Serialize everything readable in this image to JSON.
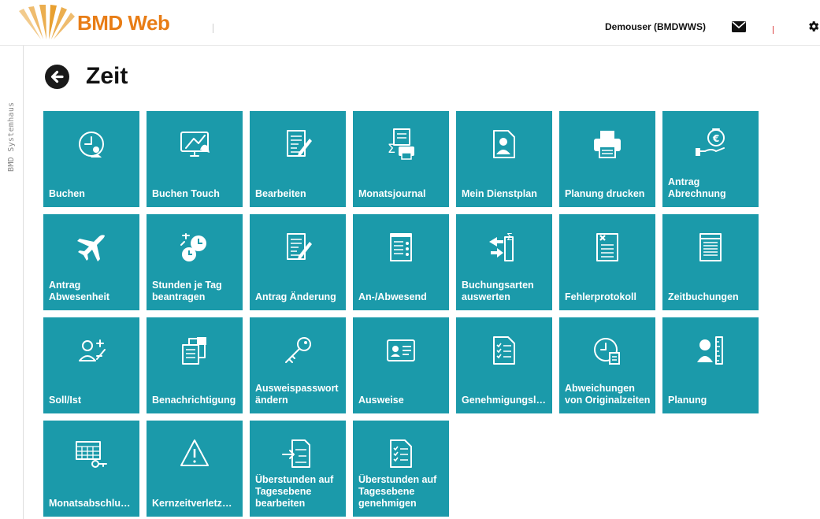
{
  "app": {
    "logo_text": "BMD Web",
    "user": "Demouser (BMDWWS)",
    "side_label": "BMD Systemhaus"
  },
  "colors": {
    "tile": "#1b9aaa",
    "brand": "#e87d16"
  },
  "page": {
    "title": "Zeit"
  },
  "tiles": [
    {
      "label": "Buchen",
      "icon": "clock-person-icon"
    },
    {
      "label": "Buchen Touch",
      "icon": "touch-monitor-icon"
    },
    {
      "label": "Bearbeiten",
      "icon": "edit-document-icon"
    },
    {
      "label": "Monatsjournal",
      "icon": "journal-printer-icon"
    },
    {
      "label": "Mein Dienstplan",
      "icon": "person-document-icon"
    },
    {
      "label": "Planung drucken",
      "icon": "printer-icon"
    },
    {
      "label": "Antrag\nAbrechnung",
      "icon": "money-bag-hand-icon"
    },
    {
      "label": "Antrag\nAbwesenheit",
      "icon": "airplane-icon"
    },
    {
      "label": "Stunden je Tag\nbeantragen",
      "icon": "clock-arrows-icon"
    },
    {
      "label": "Antrag Änderung",
      "icon": "edit-document-icon"
    },
    {
      "label": "An-/Abwesend",
      "icon": "notepad-status-icon"
    },
    {
      "label": "Buchungsarten\nauswerten",
      "icon": "sum-arrows-icon"
    },
    {
      "label": "Fehlerprotokoll",
      "icon": "document-error-icon"
    },
    {
      "label": "Zeitbuchungen",
      "icon": "list-document-icon"
    },
    {
      "label": "Soll/Ist",
      "icon": "person-plus-minus-icon"
    },
    {
      "label": "Benachrichtigung",
      "icon": "documents-stack-icon"
    },
    {
      "label": "Ausweispasswort\nändern",
      "icon": "key-icon"
    },
    {
      "label": "Ausweise",
      "icon": "id-card-icon"
    },
    {
      "label": "Genehmigungsli…",
      "icon": "checklist-document-icon"
    },
    {
      "label": "Abweichungen\nvon Originalzeiten",
      "icon": "clock-document-icon"
    },
    {
      "label": "Planung",
      "icon": "person-ruler-icon"
    },
    {
      "label": "Monatsabschlus…",
      "icon": "calendar-key-icon"
    },
    {
      "label": "Kernzeitverletzu…",
      "icon": "warning-icon"
    },
    {
      "label": "Überstunden auf\nTagesebene\nbearbeiten",
      "icon": "import-document-icon"
    },
    {
      "label": "Überstunden auf\nTagesebene\ngenehmigen",
      "icon": "checklist-document-icon"
    }
  ]
}
